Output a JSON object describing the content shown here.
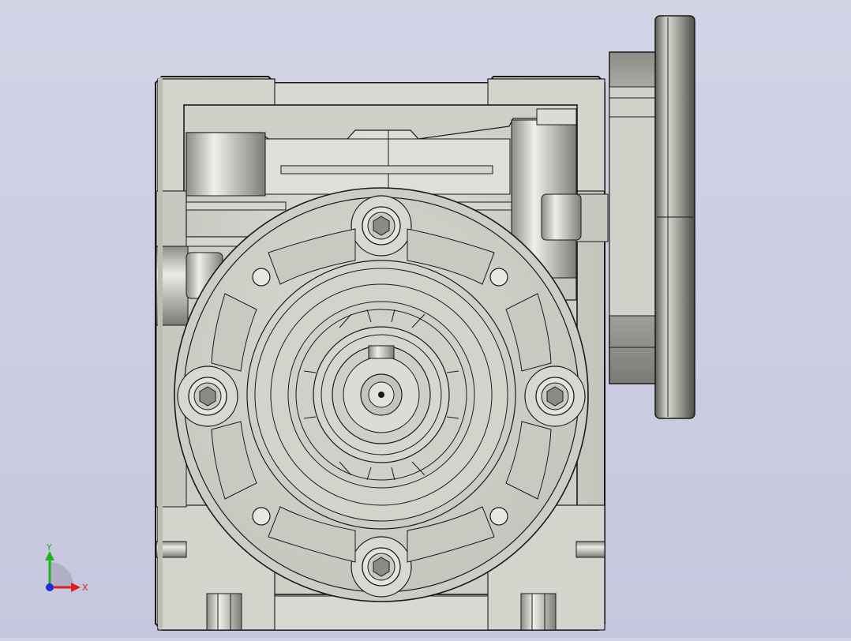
{
  "view": {
    "triad": {
      "x_label": "X",
      "y_label": "Y",
      "x_color": "#e02020",
      "y_color": "#22b022",
      "z_color": "#2030d0"
    },
    "colors": {
      "background": "#cacbe0",
      "body": "#d6d6cf",
      "body_shade": "#b9b9b1",
      "edge": "#1a1a1a"
    }
  }
}
